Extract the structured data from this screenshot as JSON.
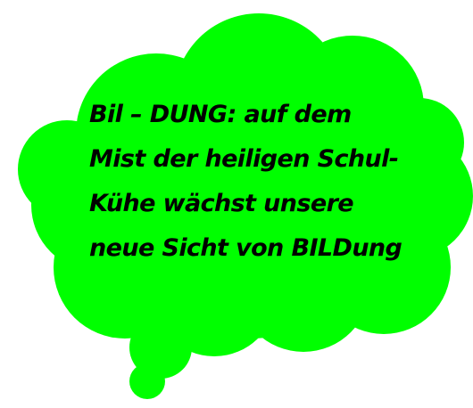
{
  "thought_bubble": {
    "fill_color": "#00FF00",
    "lines": [
      "Bil – DUNG: auf dem",
      "Mist der heiligen Schul-",
      "Kühe wächst unsere",
      "neue Sicht von BILDung"
    ]
  }
}
